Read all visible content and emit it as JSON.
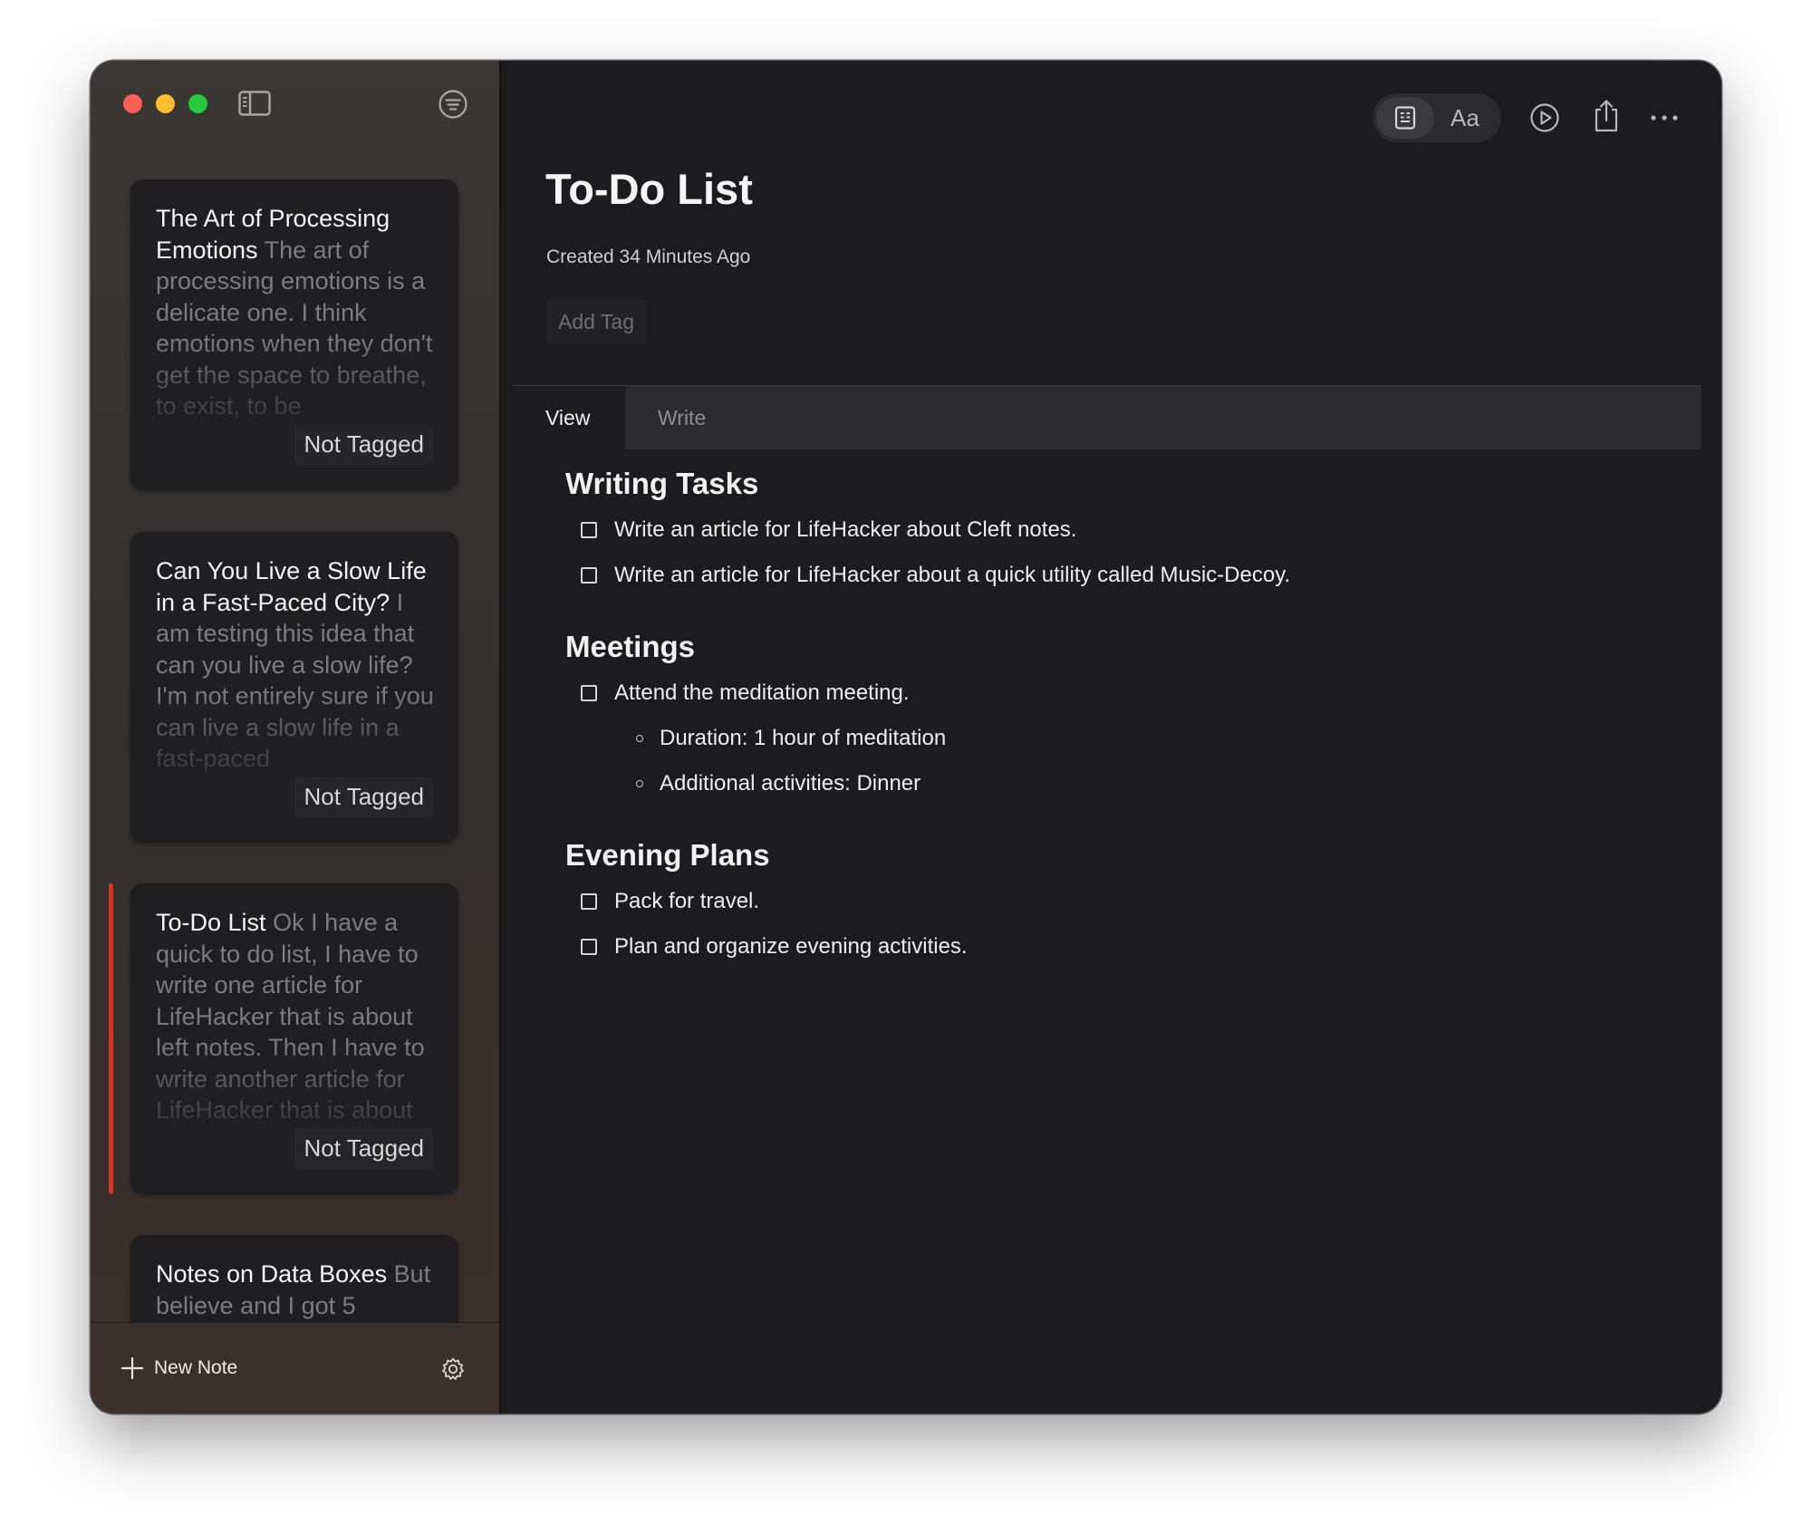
{
  "sidebar": {
    "notes": [
      {
        "title": "The Art of Processing Emotions",
        "snippet": "The art of processing emotions is a delicate one. I think emotions when they don't get the space to breathe, to exist, to be",
        "tag": "Not Tagged"
      },
      {
        "title": "Can You Live a Slow Life in a Fast-Paced City?",
        "snippet": "I am testing this idea that can you live a slow life? I'm not entirely sure if you can live a slow life in a fast-paced",
        "tag": "Not Tagged"
      },
      {
        "title": "To-Do List",
        "snippet": "Ok I have a quick to do list, I have to write one article for LifeHacker that is about left notes. Then I have to write another article for LifeHacker that is about",
        "tag": "Not Tagged",
        "selected": true
      },
      {
        "title": "Notes on Data Boxes",
        "snippet": "But believe and I got 5",
        "tag": ""
      }
    ],
    "footer": {
      "new_note_label": "New Note"
    }
  },
  "toolbar": {
    "font_label": "Aa",
    "icons": [
      "note-view-icon",
      "font-icon",
      "play-icon",
      "share-icon",
      "more-icon"
    ]
  },
  "note": {
    "title": "To-Do List",
    "created": "Created 34 Minutes Ago",
    "add_tag": "Add Tag"
  },
  "tabs": {
    "view": "View",
    "write": "Write"
  },
  "content": {
    "sections": [
      {
        "heading": "Writing Tasks",
        "items": [
          {
            "text": "Write an article for LifeHacker about Cleft notes."
          },
          {
            "text": "Write an article for LifeHacker about a quick utility called Music-Decoy."
          }
        ]
      },
      {
        "heading": "Meetings",
        "items": [
          {
            "text": "Attend the meditation meeting.",
            "subitems": [
              "Duration: 1 hour of meditation",
              "Additional activities: Dinner"
            ]
          }
        ]
      },
      {
        "heading": "Evening Plans",
        "items": [
          {
            "text": "Pack for travel."
          },
          {
            "text": "Plan and organize evening activities."
          }
        ]
      }
    ]
  },
  "colors": {
    "accent_selected": "#c9392e",
    "traffic_red": "#fe5f57",
    "traffic_yellow": "#febc2e",
    "traffic_green": "#28c840"
  }
}
